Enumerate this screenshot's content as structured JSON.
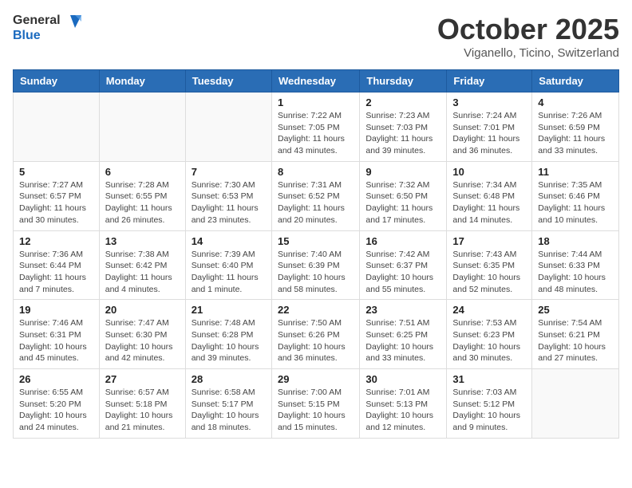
{
  "header": {
    "logo_general": "General",
    "logo_blue": "Blue",
    "month": "October 2025",
    "location": "Viganello, Ticino, Switzerland"
  },
  "days_of_week": [
    "Sunday",
    "Monday",
    "Tuesday",
    "Wednesday",
    "Thursday",
    "Friday",
    "Saturday"
  ],
  "weeks": [
    [
      {
        "day": "",
        "info": ""
      },
      {
        "day": "",
        "info": ""
      },
      {
        "day": "",
        "info": ""
      },
      {
        "day": "1",
        "info": "Sunrise: 7:22 AM\nSunset: 7:05 PM\nDaylight: 11 hours and 43 minutes."
      },
      {
        "day": "2",
        "info": "Sunrise: 7:23 AM\nSunset: 7:03 PM\nDaylight: 11 hours and 39 minutes."
      },
      {
        "day": "3",
        "info": "Sunrise: 7:24 AM\nSunset: 7:01 PM\nDaylight: 11 hours and 36 minutes."
      },
      {
        "day": "4",
        "info": "Sunrise: 7:26 AM\nSunset: 6:59 PM\nDaylight: 11 hours and 33 minutes."
      }
    ],
    [
      {
        "day": "5",
        "info": "Sunrise: 7:27 AM\nSunset: 6:57 PM\nDaylight: 11 hours and 30 minutes."
      },
      {
        "day": "6",
        "info": "Sunrise: 7:28 AM\nSunset: 6:55 PM\nDaylight: 11 hours and 26 minutes."
      },
      {
        "day": "7",
        "info": "Sunrise: 7:30 AM\nSunset: 6:53 PM\nDaylight: 11 hours and 23 minutes."
      },
      {
        "day": "8",
        "info": "Sunrise: 7:31 AM\nSunset: 6:52 PM\nDaylight: 11 hours and 20 minutes."
      },
      {
        "day": "9",
        "info": "Sunrise: 7:32 AM\nSunset: 6:50 PM\nDaylight: 11 hours and 17 minutes."
      },
      {
        "day": "10",
        "info": "Sunrise: 7:34 AM\nSunset: 6:48 PM\nDaylight: 11 hours and 14 minutes."
      },
      {
        "day": "11",
        "info": "Sunrise: 7:35 AM\nSunset: 6:46 PM\nDaylight: 11 hours and 10 minutes."
      }
    ],
    [
      {
        "day": "12",
        "info": "Sunrise: 7:36 AM\nSunset: 6:44 PM\nDaylight: 11 hours and 7 minutes."
      },
      {
        "day": "13",
        "info": "Sunrise: 7:38 AM\nSunset: 6:42 PM\nDaylight: 11 hours and 4 minutes."
      },
      {
        "day": "14",
        "info": "Sunrise: 7:39 AM\nSunset: 6:40 PM\nDaylight: 11 hours and 1 minute."
      },
      {
        "day": "15",
        "info": "Sunrise: 7:40 AM\nSunset: 6:39 PM\nDaylight: 10 hours and 58 minutes."
      },
      {
        "day": "16",
        "info": "Sunrise: 7:42 AM\nSunset: 6:37 PM\nDaylight: 10 hours and 55 minutes."
      },
      {
        "day": "17",
        "info": "Sunrise: 7:43 AM\nSunset: 6:35 PM\nDaylight: 10 hours and 52 minutes."
      },
      {
        "day": "18",
        "info": "Sunrise: 7:44 AM\nSunset: 6:33 PM\nDaylight: 10 hours and 48 minutes."
      }
    ],
    [
      {
        "day": "19",
        "info": "Sunrise: 7:46 AM\nSunset: 6:31 PM\nDaylight: 10 hours and 45 minutes."
      },
      {
        "day": "20",
        "info": "Sunrise: 7:47 AM\nSunset: 6:30 PM\nDaylight: 10 hours and 42 minutes."
      },
      {
        "day": "21",
        "info": "Sunrise: 7:48 AM\nSunset: 6:28 PM\nDaylight: 10 hours and 39 minutes."
      },
      {
        "day": "22",
        "info": "Sunrise: 7:50 AM\nSunset: 6:26 PM\nDaylight: 10 hours and 36 minutes."
      },
      {
        "day": "23",
        "info": "Sunrise: 7:51 AM\nSunset: 6:25 PM\nDaylight: 10 hours and 33 minutes."
      },
      {
        "day": "24",
        "info": "Sunrise: 7:53 AM\nSunset: 6:23 PM\nDaylight: 10 hours and 30 minutes."
      },
      {
        "day": "25",
        "info": "Sunrise: 7:54 AM\nSunset: 6:21 PM\nDaylight: 10 hours and 27 minutes."
      }
    ],
    [
      {
        "day": "26",
        "info": "Sunrise: 6:55 AM\nSunset: 5:20 PM\nDaylight: 10 hours and 24 minutes."
      },
      {
        "day": "27",
        "info": "Sunrise: 6:57 AM\nSunset: 5:18 PM\nDaylight: 10 hours and 21 minutes."
      },
      {
        "day": "28",
        "info": "Sunrise: 6:58 AM\nSunset: 5:17 PM\nDaylight: 10 hours and 18 minutes."
      },
      {
        "day": "29",
        "info": "Sunrise: 7:00 AM\nSunset: 5:15 PM\nDaylight: 10 hours and 15 minutes."
      },
      {
        "day": "30",
        "info": "Sunrise: 7:01 AM\nSunset: 5:13 PM\nDaylight: 10 hours and 12 minutes."
      },
      {
        "day": "31",
        "info": "Sunrise: 7:03 AM\nSunset: 5:12 PM\nDaylight: 10 hours and 9 minutes."
      },
      {
        "day": "",
        "info": ""
      }
    ]
  ]
}
